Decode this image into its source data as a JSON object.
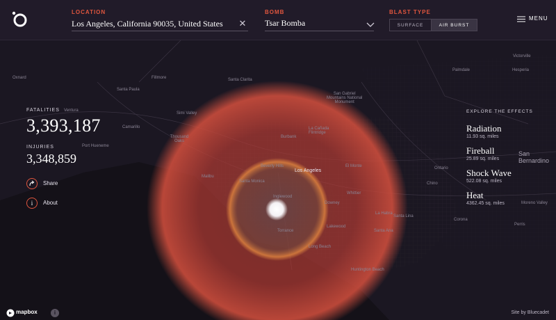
{
  "header": {
    "location": {
      "label": "LOCATION",
      "value": "Los Angeles, California 90035, United States"
    },
    "bomb": {
      "label": "BOMB",
      "value": "Tsar Bomba"
    },
    "blast_type": {
      "label": "BLAST TYPE",
      "options": [
        "SURFACE",
        "AIR BURST"
      ],
      "selected": "AIR BURST"
    },
    "menu_label": "MENU"
  },
  "stats": {
    "fatalities_label": "FATALITIES",
    "fatalities_value": "3,393,187",
    "injuries_label": "INJURIES",
    "injuries_value": "3,348,859"
  },
  "actions": {
    "share": "Share",
    "about": "About"
  },
  "effects": {
    "title": "EXPLORE THE EFFECTS",
    "items": [
      {
        "name": "Radiation",
        "area": "11.93 sq. miles"
      },
      {
        "name": "Fireball",
        "area": "25.89 sq. miles"
      },
      {
        "name": "Shock Wave",
        "area": "522.08 sq. miles"
      },
      {
        "name": "Heat",
        "area": "4362.45 sq. miles"
      }
    ]
  },
  "map": {
    "labels": {
      "ventura": "Ventura",
      "fillmore": "Fillmore",
      "santa_clarita": "Santa Clarita",
      "santa_paula": "Santa Paula",
      "simi_valley": "Simi Valley",
      "camarillo": "Camarillo",
      "thousand_oaks": "Thousand\nOaks",
      "port_hueneme": "Port Hueneme",
      "san_gabriel": "San Gabriel\nMountains National\nMonument",
      "la_canada": "La Cañada\nFlintridge",
      "burbank": "Burbank",
      "beverly_hills": "Beverly Hills",
      "los_angeles": "Los Angeles",
      "el_monte": "El Monte",
      "malibu": "Malibu",
      "santa_monica": "Santa Monica",
      "inglewood": "Inglewood",
      "downey": "Downey",
      "whittier": "Whittier",
      "torrance": "Torrance",
      "lakewood": "Lakewood",
      "long_beach": "Long Beach",
      "santa_ana": "Santa Ana",
      "huntington_beach": "Huntington Beach",
      "ontario": "Ontario",
      "chino": "Chino",
      "corona": "Corona",
      "la_habra": "La Habra",
      "santa_lina": "Santa Lina",
      "san_bernardino": "San\nBernardino",
      "moreno_valley": "Moreno Valley",
      "perris": "Perris",
      "hesperia": "Hesperia",
      "palmdale": "Palmdale",
      "victorville": "Victorville",
      "oxnard": "Oxnard"
    }
  },
  "footer": {
    "brand": "mapbox",
    "credit": "Site by Bluecadet",
    "info_glyph": "i"
  }
}
